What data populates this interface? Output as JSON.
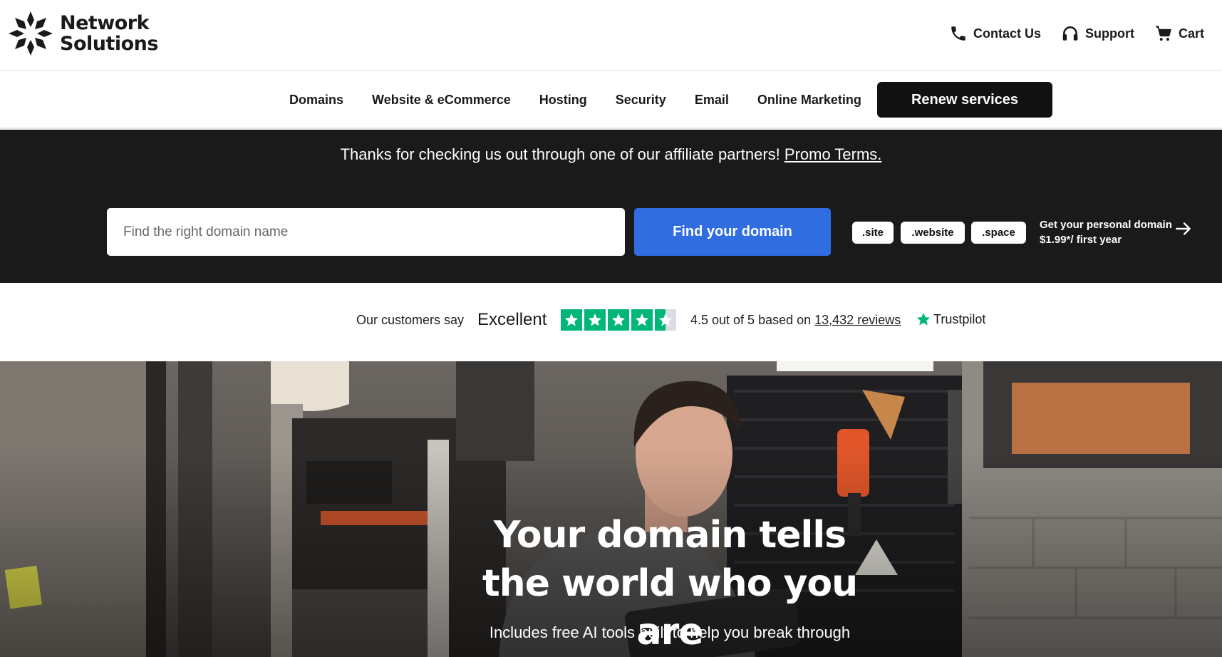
{
  "brand": {
    "line1": "Network",
    "line2": "Solutions",
    "logo_icon": "network-solutions-star-icon"
  },
  "utility_nav": [
    {
      "label": "Contact Us",
      "icon": "phone-icon"
    },
    {
      "label": "Support",
      "icon": "headset-icon"
    },
    {
      "label": "Cart",
      "icon": "cart-icon"
    }
  ],
  "main_nav": {
    "items": [
      "Domains",
      "Website & eCommerce",
      "Hosting",
      "Security",
      "Email",
      "Online Marketing"
    ],
    "renew_label": "Renew services"
  },
  "promo": {
    "text": "Thanks for checking us out through one of our affiliate partners! ",
    "link": "Promo Terms."
  },
  "search": {
    "placeholder": "Find the right domain name",
    "button_label": "Find your domain",
    "tlds": [
      ".site",
      ".website",
      ".space"
    ],
    "personal_line1": "Get your personal domain",
    "personal_line2": "$1.99*/ first year",
    "arrow_icon": "arrow-right-icon"
  },
  "trustpilot": {
    "lead": "Our customers say",
    "rating_word": "Excellent",
    "score_text": "4.5 out of 5 based on ",
    "reviews_link": "13,432 reviews",
    "brand": "Trustpilot",
    "stars": 4.5,
    "star_color": "#00b67a"
  },
  "hero": {
    "title": "Your domain tells the world who you are",
    "subtitle": "Includes free AI tools built to help you break through"
  },
  "colors": {
    "dark_band": "#1a1a1a",
    "find_button": "#2f6de1",
    "renew_button": "#111111"
  }
}
